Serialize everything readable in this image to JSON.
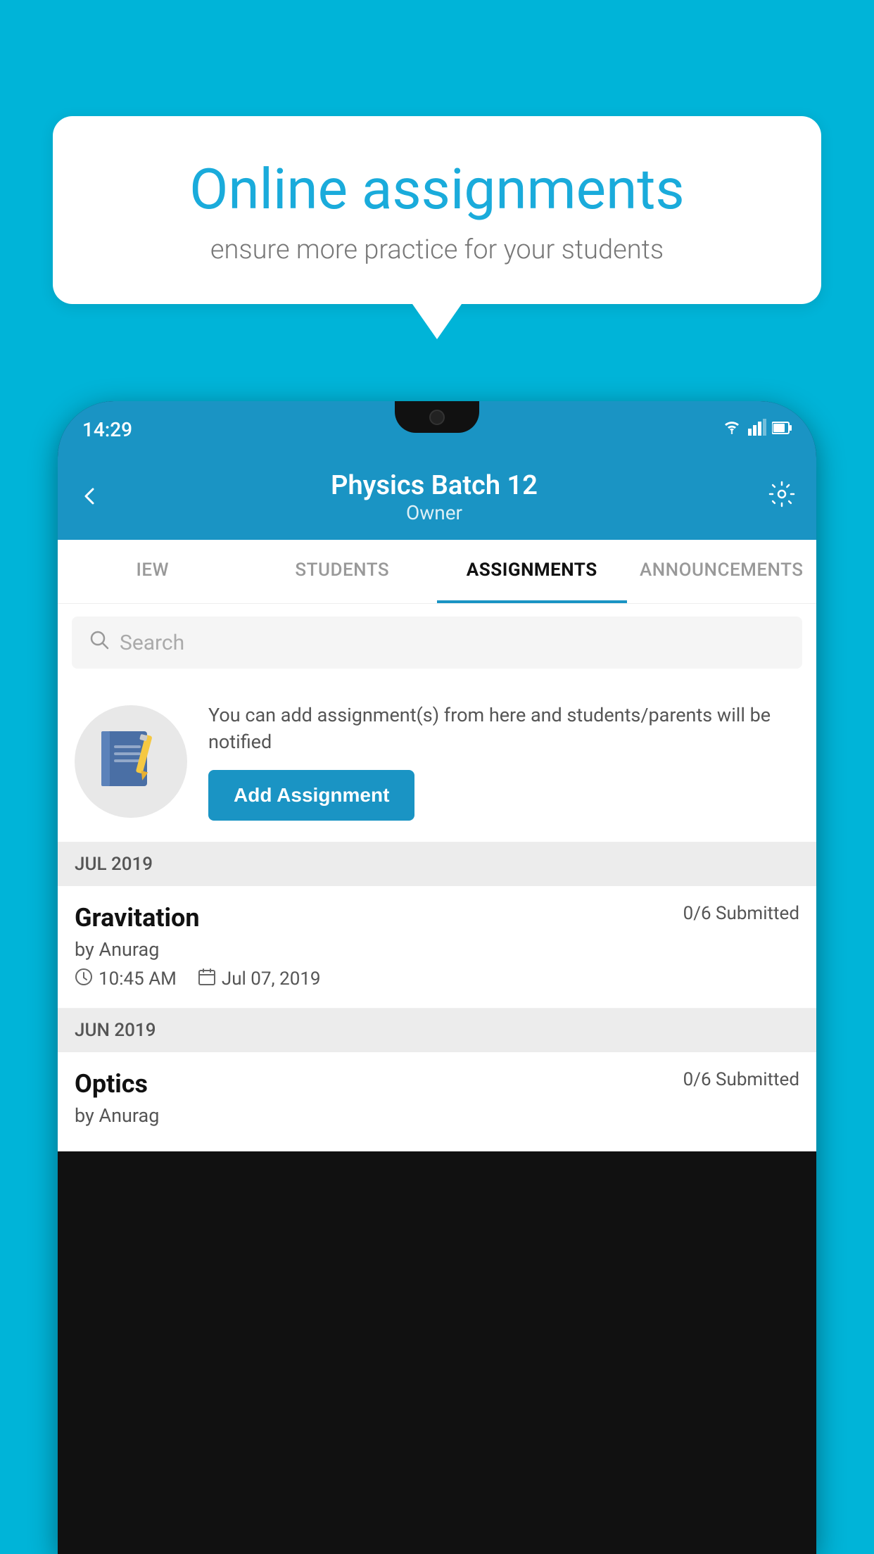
{
  "background": {
    "color": "#00B4D8"
  },
  "speech_bubble": {
    "title": "Online assignments",
    "subtitle": "ensure more practice for your students"
  },
  "phone": {
    "status_bar": {
      "time": "14:29",
      "icons": [
        "wifi",
        "signal",
        "battery"
      ]
    },
    "header": {
      "title": "Physics Batch 12",
      "subtitle": "Owner"
    },
    "tabs": [
      {
        "label": "IEW",
        "active": false
      },
      {
        "label": "STUDENTS",
        "active": false
      },
      {
        "label": "ASSIGNMENTS",
        "active": true
      },
      {
        "label": "ANNOUNCEMENTS",
        "active": false
      }
    ],
    "search": {
      "placeholder": "Search"
    },
    "add_assignment": {
      "info_text": "You can add assignment(s) from here and students/parents will be notified",
      "button_label": "Add Assignment"
    },
    "sections": [
      {
        "header": "JUL 2019",
        "items": [
          {
            "name": "Gravitation",
            "submitted": "0/6 Submitted",
            "by": "by Anurag",
            "time": "10:45 AM",
            "date": "Jul 07, 2019"
          }
        ]
      },
      {
        "header": "JUN 2019",
        "items": [
          {
            "name": "Optics",
            "submitted": "0/6 Submitted",
            "by": "by Anurag",
            "time": "",
            "date": ""
          }
        ]
      }
    ]
  }
}
